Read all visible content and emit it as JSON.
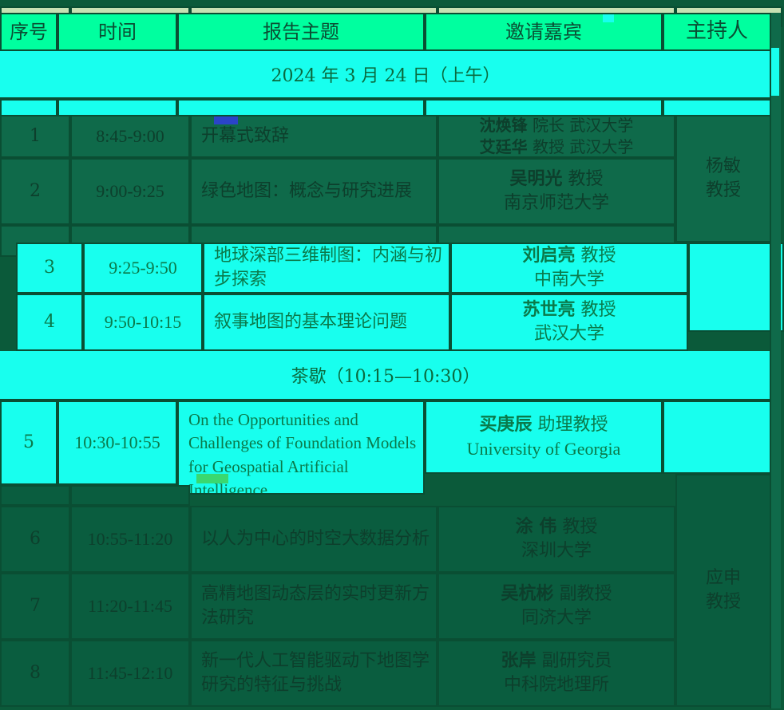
{
  "header": {
    "index": "序号",
    "time": "时间",
    "topic": "报告主题",
    "guest": "邀请嘉宾",
    "host": "主持人"
  },
  "date_row": "2024 年  3 月  24 日（上午）",
  "break_row": "茶歇（10:15—10:30）",
  "rows": [
    {
      "index": "1",
      "time": "8:45-9:00",
      "topic": "开幕式致辞",
      "guests": [
        {
          "name": "沈焕锋",
          "title": "院长  武汉大学"
        },
        {
          "name": "艾廷华",
          "title": "教授  武汉大学"
        }
      ]
    },
    {
      "index": "2",
      "time": "9:00-9:25",
      "topic": "绿色地图：概念与研究进展",
      "guests": [
        {
          "name": "吴明光",
          "title": "教授"
        }
      ],
      "affiliation": "南京师范大学"
    },
    {
      "index": "3",
      "time": "9:25-9:50",
      "topic": "地球深部三维制图：内涵与初步探索",
      "guests": [
        {
          "name": "刘启亮",
          "title": "教授"
        }
      ],
      "affiliation": "中南大学"
    },
    {
      "index": "4",
      "time": "9:50-10:15",
      "topic": "叙事地图的基本理论问题",
      "guests": [
        {
          "name": "苏世亮",
          "title": "教授"
        }
      ],
      "affiliation": "武汉大学"
    },
    {
      "index": "5",
      "time": "10:30-10:55",
      "topic": "On the Opportunities and Challenges of Foundation Models for Geospatial Artificial Intelligence",
      "guests": [
        {
          "name": "买庚辰",
          "title": "助理教授"
        }
      ],
      "affiliation": "University of Georgia"
    },
    {
      "index": "6",
      "time": "10:55-11:20",
      "topic": "以人为中心的时空大数据分析",
      "guests": [
        {
          "name": "涂 伟",
          "title": "教授"
        }
      ],
      "affiliation": "深圳大学"
    },
    {
      "index": "7",
      "time": "11:20-11:45",
      "topic": "高精地图动态层的实时更新方法研究",
      "guests": [
        {
          "name": "吴杭彬",
          "title": "副教授"
        }
      ],
      "affiliation": "同济大学"
    },
    {
      "index": "8",
      "time": "11:45-12:10",
      "topic": "新一代人工智能驱动下地图学研究的特征与挑战",
      "guests": [
        {
          "name": "张岸",
          "title": "副研究员"
        }
      ],
      "affiliation": "中科院地理所"
    }
  ],
  "hosts": {
    "morning_1": "杨敏教授",
    "morning_2": "应申教授"
  }
}
